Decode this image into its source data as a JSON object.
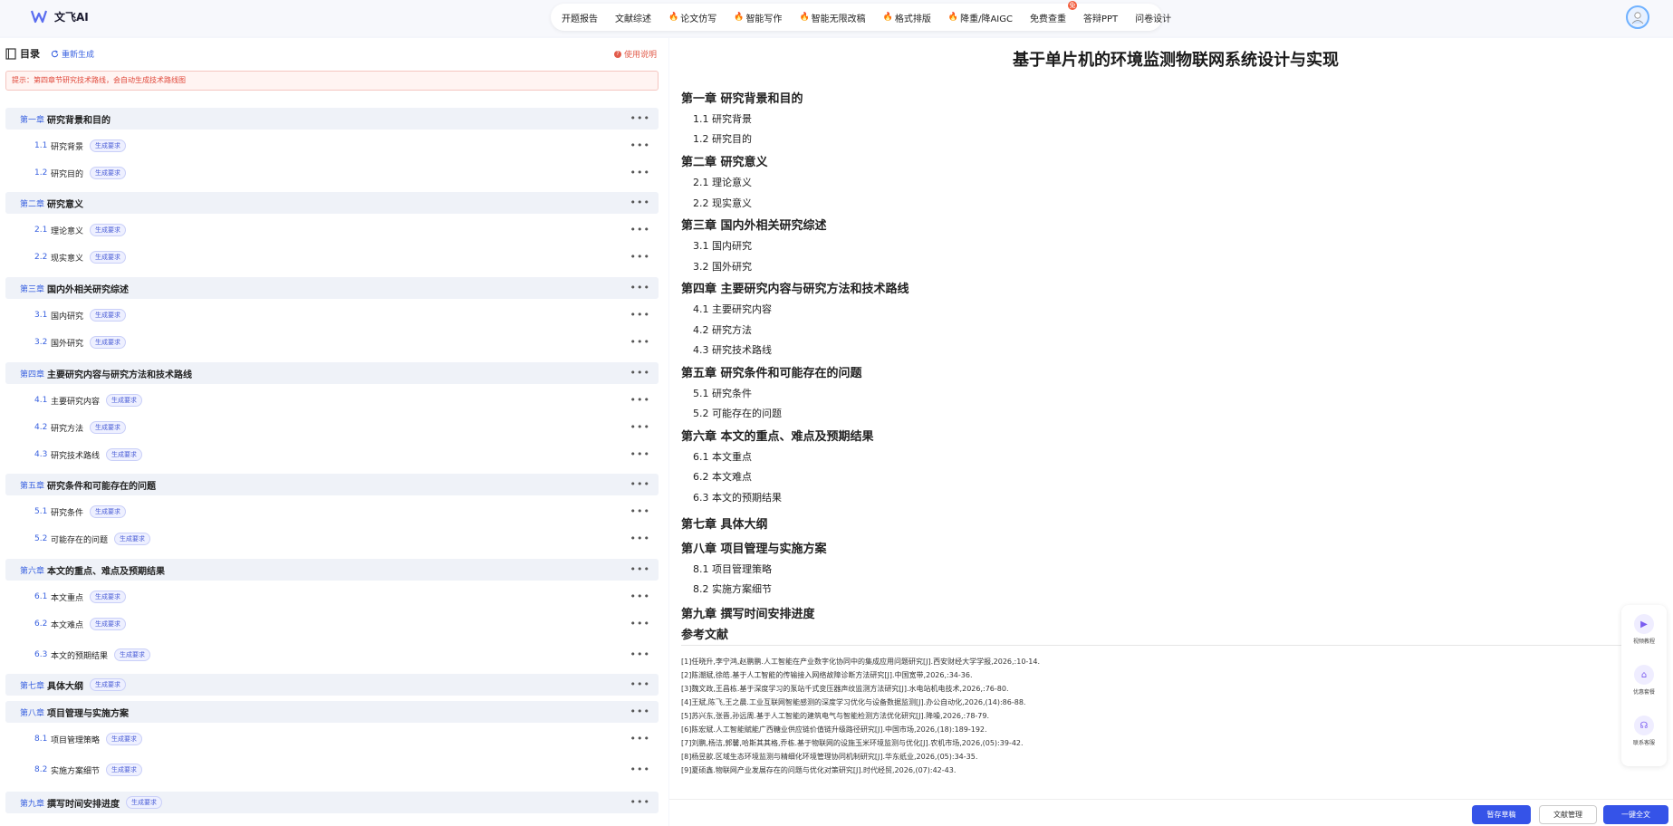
{
  "app": {
    "name": "文飞AI"
  },
  "nav": [
    {
      "label": "开题报告",
      "hot": false,
      "badge": ""
    },
    {
      "label": "文献综述",
      "hot": false,
      "badge": ""
    },
    {
      "label": "论文仿写",
      "hot": true,
      "badge": ""
    },
    {
      "label": "智能写作",
      "hot": true,
      "badge": ""
    },
    {
      "label": "智能无限改稿",
      "hot": true,
      "badge": ""
    },
    {
      "label": "格式排版",
      "hot": true,
      "badge": ""
    },
    {
      "label": "降重/降AIGC",
      "hot": true,
      "badge": ""
    },
    {
      "label": "免费查重",
      "hot": false,
      "badge": "免"
    },
    {
      "label": "答辩PPT",
      "hot": false,
      "badge": ""
    },
    {
      "label": "问卷设计",
      "hot": false,
      "badge": ""
    }
  ],
  "toc": {
    "title": "目录",
    "regenerate": "重新生成",
    "help": "使用说明",
    "tip": "提示：第四章节研究技术路线，会自动生成技术路线图",
    "tag": "生成要求",
    "rows": [
      {
        "kind": "chapter",
        "num": "第一章",
        "label": "研究背景和目的",
        "tag": false
      },
      {
        "kind": "section",
        "num": "1.1",
        "label": "研究背景",
        "tag": true
      },
      {
        "kind": "section",
        "num": "1.2",
        "label": "研究目的",
        "tag": true
      },
      {
        "kind": "chapter",
        "num": "第二章",
        "label": "研究意义",
        "tag": false
      },
      {
        "kind": "section",
        "num": "2.1",
        "label": "理论意义",
        "tag": true
      },
      {
        "kind": "section",
        "num": "2.2",
        "label": "现实意义",
        "tag": true
      },
      {
        "kind": "chapter",
        "num": "第三章",
        "label": "国内外相关研究综述",
        "tag": false
      },
      {
        "kind": "section",
        "num": "3.1",
        "label": "国内研究",
        "tag": true
      },
      {
        "kind": "section",
        "num": "3.2",
        "label": "国外研究",
        "tag": true
      },
      {
        "kind": "chapter",
        "num": "第四章",
        "label": "主要研究内容与研究方法和技术路线",
        "tag": false
      },
      {
        "kind": "section",
        "num": "4.1",
        "label": "主要研究内容",
        "tag": true
      },
      {
        "kind": "section",
        "num": "4.2",
        "label": "研究方法",
        "tag": true
      },
      {
        "kind": "section",
        "num": "4.3",
        "label": "研究技术路线",
        "tag": true
      },
      {
        "kind": "chapter",
        "num": "第五章",
        "label": "研究条件和可能存在的问题",
        "tag": false
      },
      {
        "kind": "section",
        "num": "5.1",
        "label": "研究条件",
        "tag": true
      },
      {
        "kind": "section",
        "num": "5.2",
        "label": "可能存在的问题",
        "tag": true
      },
      {
        "kind": "chapter",
        "num": "第六章",
        "label": "本文的重点、难点及预期结果",
        "tag": false
      },
      {
        "kind": "section",
        "num": "6.1",
        "label": "本文重点",
        "tag": true
      },
      {
        "kind": "section",
        "num": "6.2",
        "label": "本文难点",
        "tag": true
      },
      {
        "kind": "section",
        "num": "6.3",
        "label": "本文的预期结果",
        "tag": true
      },
      {
        "kind": "chapter",
        "num": "第七章",
        "label": "具体大纲",
        "tag": true
      },
      {
        "kind": "chapter",
        "num": "第八章",
        "label": "项目管理与实施方案",
        "tag": false
      },
      {
        "kind": "section",
        "num": "8.1",
        "label": "项目管理策略",
        "tag": true
      },
      {
        "kind": "section",
        "num": "8.2",
        "label": "实施方案细节",
        "tag": true
      },
      {
        "kind": "chapter",
        "num": "第九章",
        "label": "撰写时间安排进度",
        "tag": true
      }
    ]
  },
  "doc": {
    "title": "基于单片机的环境监测物联网系统设计与实现",
    "outline": [
      {
        "kind": "ch",
        "text": "第一章 研究背景和目的"
      },
      {
        "kind": "sec",
        "text": "1.1 研究背景"
      },
      {
        "kind": "sec",
        "text": "1.2 研究目的"
      },
      {
        "kind": "ch",
        "text": "第二章 研究意义"
      },
      {
        "kind": "sec",
        "text": "2.1 理论意义"
      },
      {
        "kind": "sec",
        "text": "2.2 现实意义"
      },
      {
        "kind": "ch",
        "text": "第三章 国内外相关研究综述"
      },
      {
        "kind": "sec",
        "text": "3.1 国内研究"
      },
      {
        "kind": "sec",
        "text": "3.2 国外研究"
      },
      {
        "kind": "ch",
        "text": "第四章 主要研究内容与研究方法和技术路线"
      },
      {
        "kind": "sec",
        "text": "4.1 主要研究内容"
      },
      {
        "kind": "sec",
        "text": "4.2 研究方法"
      },
      {
        "kind": "sec",
        "text": "4.3 研究技术路线"
      },
      {
        "kind": "ch",
        "text": "第五章 研究条件和可能存在的问题"
      },
      {
        "kind": "sec",
        "text": "5.1 研究条件"
      },
      {
        "kind": "sec",
        "text": "5.2 可能存在的问题"
      },
      {
        "kind": "ch",
        "text": "第六章 本文的重点、难点及预期结果"
      },
      {
        "kind": "sec",
        "text": "6.1 本文重点"
      },
      {
        "kind": "sec",
        "text": "6.2 本文难点"
      },
      {
        "kind": "sec",
        "text": "6.3 本文的预期结果"
      },
      {
        "kind": "ch",
        "text": "第七章 具体大纲"
      },
      {
        "kind": "ch",
        "text": "第八章 项目管理与实施方案"
      },
      {
        "kind": "sec",
        "text": "8.1 项目管理策略"
      },
      {
        "kind": "sec",
        "text": "8.2 实施方案细节"
      },
      {
        "kind": "ch",
        "text": "第九章 撰写时间安排进度"
      }
    ],
    "refs_title": "参考文献",
    "refs": [
      "[1]任晓升,李宁鸿,赵鹏鹏.人工智能在产业数字化协同中的集成应用问题研究[J].西安财经大学学报,2026,:10-14.",
      "[2]陈潮斌,徐皓.基于人工智能的传输接入网络故障诊断方法研究[J].中国宽带,2026,:34-36.",
      "[3]魏文政,王昌栋.基于深度学习的泵站千式变压器声纹监测方法研究[J].水电站机电技术,2026,:76-80.",
      "[4]王斌,陈飞,王之晨.工业互联网智能感测的深度学习优化与设备数据监测[J].办公自动化,2026,(14):86-88.",
      "[5]苏兴东,张晋,孙远周.基于人工智能的建筑电气与智能检测方法优化研究[J].降噪,2026,:78-79.",
      "[6]陈宏斌.人工智能赋能广西糖业供应链价值链升级路径研究[J].中国市场,2026,(18):189-192.",
      "[7]刘鹏,杨洁,郭馨,哈斯其其格,乔栋.基于物联网的设施玉米环境监测与优化[J].农机市场,2026,(05):39-42.",
      "[8]杨昱歆.区域生态环境监测与精细化环境管理协同机制研究[J].华东纸业,2026,(05):34-35.",
      "[9]夏硕鑫.物联网产业发展存在的问题与优化对策研究[J].时代经贸,2026,(07):42-43."
    ]
  },
  "buttons": {
    "draft": "暂存草稿",
    "literature": "文献管理",
    "full": "一键全文"
  },
  "float": [
    {
      "label": "视频教程",
      "icon": "video-icon"
    },
    {
      "label": "优惠套餐",
      "icon": "gift-icon"
    },
    {
      "label": "联系客服",
      "icon": "headset-icon"
    }
  ],
  "colors": {
    "accent": "#3553e8",
    "link": "#3a62e0",
    "hot": "#e5412b",
    "tip": "#e0483a"
  }
}
